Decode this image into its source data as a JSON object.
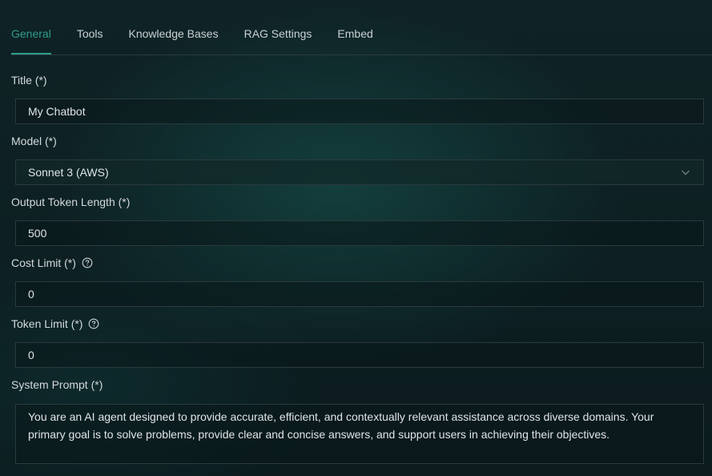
{
  "tabs": [
    {
      "label": "General",
      "active": true
    },
    {
      "label": "Tools",
      "active": false
    },
    {
      "label": "Knowledge Bases",
      "active": false
    },
    {
      "label": "RAG Settings",
      "active": false
    },
    {
      "label": "Embed",
      "active": false
    }
  ],
  "form": {
    "title": {
      "label": "Title (*)",
      "value": "My Chatbot"
    },
    "model": {
      "label": "Model (*)",
      "value": "Sonnet 3 (AWS)"
    },
    "output_token_length": {
      "label": "Output Token Length (*)",
      "value": "500"
    },
    "cost_limit": {
      "label": "Cost Limit (*)",
      "value": "0"
    },
    "token_limit": {
      "label": "Token Limit (*)",
      "value": "0"
    },
    "system_prompt": {
      "label": "System Prompt (*)",
      "value": "You are an AI agent designed to provide accurate, efficient, and contextually relevant assistance across diverse domains. Your primary goal is to solve problems, provide clear and concise answers, and support users in achieving their objectives."
    }
  },
  "icons": {
    "help": "question-circle-icon",
    "dropdown": "chevron-down-icon"
  },
  "colors": {
    "accent": "#2e9c8d",
    "text": "#d2d9dc",
    "border": "#2b3a3d"
  }
}
